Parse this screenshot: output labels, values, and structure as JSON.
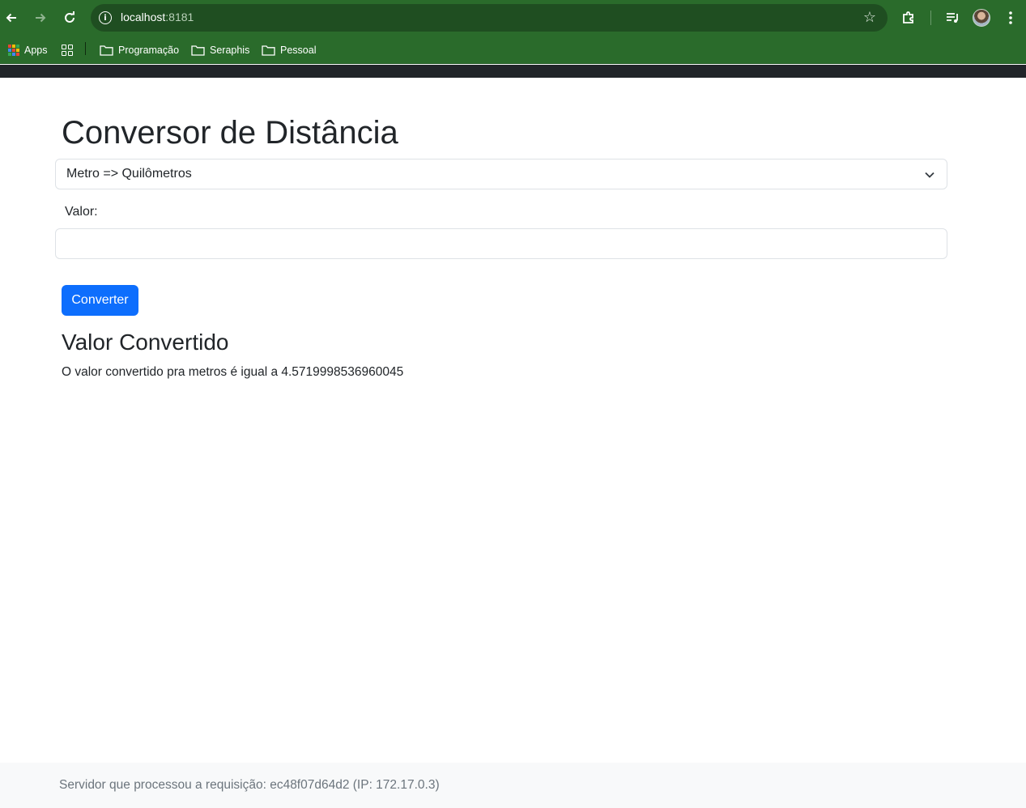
{
  "browser": {
    "url_host": "localhost",
    "url_port": ":8181",
    "bookmarks": [
      {
        "label": "Apps"
      },
      {
        "label": "Programação"
      },
      {
        "label": "Seraphis"
      },
      {
        "label": "Pessoal"
      }
    ]
  },
  "page": {
    "title": "Conversor de Distância",
    "conversion_select": {
      "selected": "Metro => Quilômetros"
    },
    "value_label": "Valor:",
    "value_input": "",
    "convert_button": "Converter",
    "result_title": "Valor Convertido",
    "result_text": "O valor convertido pra metros é igual a 4.5719998536960045"
  },
  "footer": {
    "text": "Servidor que processou a requisição: ec48f07d64d2 (IP: 172.17.0.3)"
  },
  "colors": {
    "chrome": "#2a6b2b",
    "primary": "#0d6efd",
    "navbar": "#212529",
    "footer_bg": "#f8f9fa"
  }
}
